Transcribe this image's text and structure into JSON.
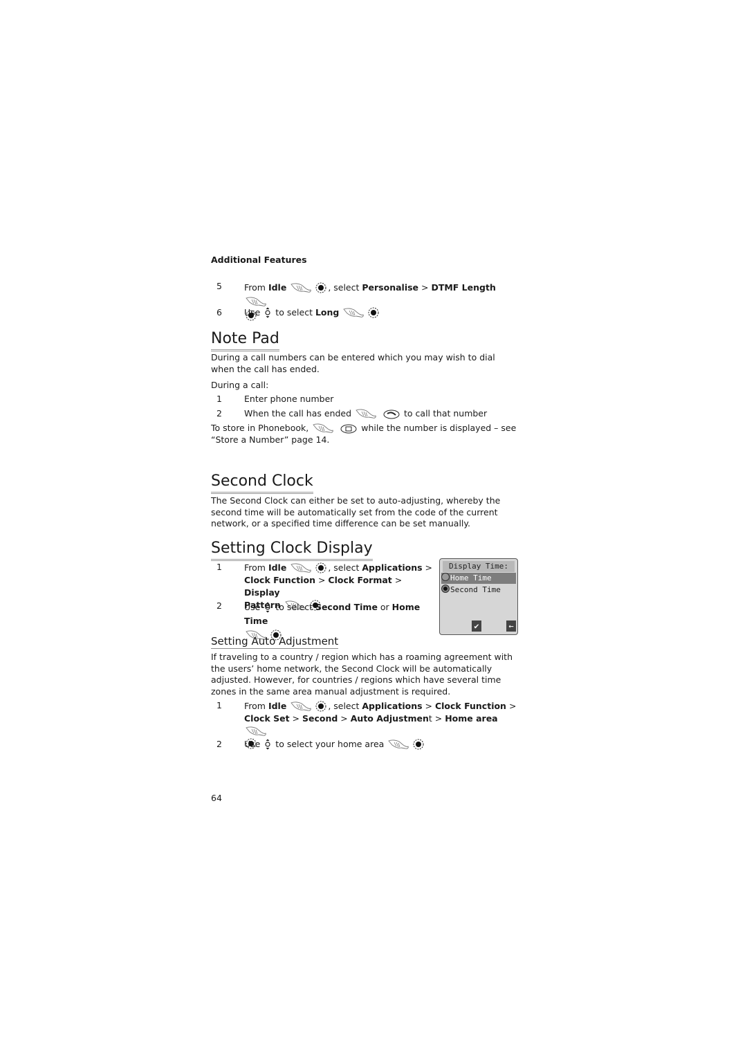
{
  "running_head": "Additional Features",
  "dtmf_steps": [
    {
      "num": "5",
      "parts": [
        "From ",
        "Idle",
        ", select ",
        "Personalise",
        " > ",
        "DTMF Length"
      ]
    },
    {
      "num": "6",
      "parts": [
        "Use ",
        " to select ",
        "Long"
      ]
    }
  ],
  "note_pad": {
    "heading": "Note Pad",
    "intro": "During a call numbers can be entered which you may wish to dial when the call has ended.",
    "during": "During a call:",
    "steps": [
      {
        "num": "1",
        "text": "Enter phone number"
      },
      {
        "num": "2",
        "text_before": "When the call has ended",
        "text_after": "to call that number"
      }
    ],
    "store_before": "To store in Phonebook,",
    "store_after": "while the number is displayed – see “Store a Number” page 14."
  },
  "second_clock": {
    "heading": "Second Clock",
    "body": "The Second Clock can either be set to auto-adjusting, whereby the second time will be automatically set from the code of the current network, or a specified time difference can be set manually."
  },
  "clock_display": {
    "heading": "Setting Clock Display",
    "step1": {
      "num": "1",
      "from": "From ",
      "idle": "Idle",
      "select": ", select ",
      "applications": "Applications",
      "gt": " > ",
      "clock_function": "Clock Function",
      "clock_format": "Clock Format",
      "display_pattern_a": "Display",
      "display_pattern_b": "Pattern"
    },
    "step2": {
      "num": "2",
      "use": "Use ",
      "to_select": " to select ",
      "second_time": "Second Time",
      "or": " or ",
      "home_time": "Home Time"
    },
    "screen": {
      "title": "Display Time:",
      "options": [
        {
          "label": "Home Time",
          "selected": true,
          "radio_on": false
        },
        {
          "label": "Second Time",
          "selected": false,
          "radio_on": true
        }
      ],
      "softkey_left": "✔",
      "softkey_right": "←"
    }
  },
  "auto_adjust": {
    "heading": "Setting Auto Adjustment",
    "body": "If traveling to a country / region which has a roaming agreement with the users’ home network, the Second Clock will be automatically adjusted. However, for countries / regions which have several time zones in the same area manual adjustment is required.",
    "step1": {
      "num": "1",
      "from": "From ",
      "idle": "Idle",
      "select": ", select ",
      "applications": "Applications",
      "gt": " > ",
      "clock_function": "Clock Function",
      "clock_set": "Clock Set",
      "second": "Second",
      "auto_adjustment": "Auto Adjustmen",
      "auto_adjustment_t": "t",
      "home_area": "Home area"
    },
    "step2": {
      "num": "2",
      "use": "Use ",
      "rest": " to select your home area"
    }
  },
  "page_number": "64"
}
